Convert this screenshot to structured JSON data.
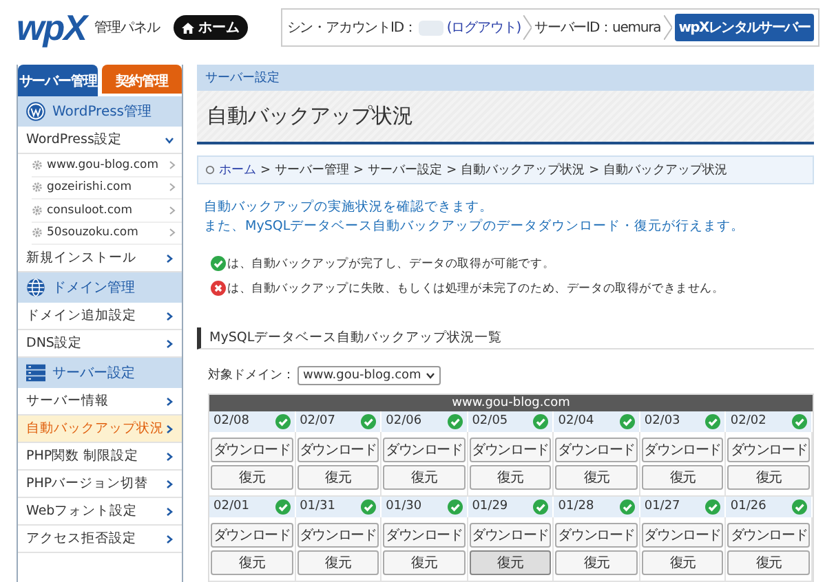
{
  "header": {
    "logo": "wpX",
    "panel_label": "管理パネル",
    "home_button": "ホーム",
    "account_label": "シン・アカウントID：",
    "account_id_blurred": true,
    "logout_link": "(ログアウト)",
    "server_id": "サーバーID：uemura",
    "service_button": "wpXレンタルサーバー"
  },
  "sidebar": {
    "tabs": [
      {
        "label": "サーバー管理",
        "selected": true,
        "color": "#1f5aa6"
      },
      {
        "label": "契約管理",
        "selected": false,
        "color": "#e0600f"
      }
    ],
    "sections": [
      {
        "kind": "wordpress",
        "title": "WordPress管理",
        "items": [
          {
            "label": "WordPress設定",
            "selected": false,
            "expanded": true,
            "children": [
              {
                "label": "www.gou-blog.com"
              },
              {
                "label": "gozeirishi.com"
              },
              {
                "label": "consuloot.com"
              },
              {
                "label": "50souzoku.com"
              }
            ]
          },
          {
            "label": "新規インストール",
            "selected": false,
            "expanded": false
          }
        ]
      },
      {
        "kind": "domain",
        "title": "ドメイン管理",
        "items": [
          {
            "label": "ドメイン追加設定",
            "selected": false,
            "expanded": false
          },
          {
            "label": "DNS設定",
            "selected": false,
            "expanded": false
          }
        ]
      },
      {
        "kind": "server",
        "title": "サーバー設定",
        "items": [
          {
            "label": "サーバー情報",
            "selected": false,
            "expanded": false
          },
          {
            "label": "自動バックアップ状況",
            "selected": true,
            "expanded": false
          },
          {
            "label": "PHP関数 制限設定",
            "selected": false,
            "expanded": false
          },
          {
            "label": "PHPバージョン切替",
            "selected": false,
            "expanded": false
          },
          {
            "label": "Webフォント設定",
            "selected": false,
            "expanded": false
          },
          {
            "label": "アクセス拒否設定",
            "selected": false,
            "expanded": false
          }
        ]
      }
    ]
  },
  "main": {
    "section_label": "サーバー設定",
    "title": "自動バックアップ状況",
    "breadcrumb": [
      {
        "label": "ホーム",
        "link": true
      },
      {
        "sep": ">",
        "label": "サーバー管理",
        "link": false
      },
      {
        "sep": ">",
        "label": "サーバー設定",
        "link": false
      },
      {
        "sep": ">",
        "label": "自動バックアップ状況",
        "link": false
      },
      {
        "sep": ">",
        "label": "自動バックアップ状況",
        "link": false
      }
    ],
    "description": [
      "自動バックアップの実施状況を確認できます。",
      "また、MySQLデータベース自動バックアップのデータダウンロード・復元が行えます。"
    ],
    "legend": [
      {
        "kind": "ok",
        "text": "は、自動バックアップが完了し、データの取得が可能です。"
      },
      {
        "kind": "error",
        "text": "は、自動バックアップに失敗、もしくは処理が未完了のため、データの取得ができません。"
      }
    ],
    "subheading": "MySQLデータベース自動バックアップ状況一覧",
    "domain_select": {
      "label": "対象ドメイン：",
      "value": "www.gou-blog.com"
    },
    "backups": {
      "domain": "www.gou-blog.com",
      "days": [
        {
          "date": "02/08",
          "complete": true,
          "download": "ダウンロード",
          "restore": "復元",
          "restore_pressed": false
        },
        {
          "date": "02/07",
          "complete": true,
          "download": "ダウンロード",
          "restore": "復元",
          "restore_pressed": false
        },
        {
          "date": "02/06",
          "complete": true,
          "download": "ダウンロード",
          "restore": "復元",
          "restore_pressed": false
        },
        {
          "date": "02/05",
          "complete": true,
          "download": "ダウンロード",
          "restore": "復元",
          "restore_pressed": false
        },
        {
          "date": "02/04",
          "complete": true,
          "download": "ダウンロード",
          "restore": "復元",
          "restore_pressed": false
        },
        {
          "date": "02/03",
          "complete": true,
          "download": "ダウンロード",
          "restore": "復元",
          "restore_pressed": false
        },
        {
          "date": "02/02",
          "complete": true,
          "download": "ダウンロード",
          "restore": "復元",
          "restore_pressed": false
        },
        {
          "date": "02/01",
          "complete": true,
          "download": "ダウンロード",
          "restore": "復元",
          "restore_pressed": false
        },
        {
          "date": "01/31",
          "complete": true,
          "download": "ダウンロード",
          "restore": "復元",
          "restore_pressed": false
        },
        {
          "date": "01/30",
          "complete": true,
          "download": "ダウンロード",
          "restore": "復元",
          "restore_pressed": false
        },
        {
          "date": "01/29",
          "complete": true,
          "download": "ダウンロード",
          "restore": "復元",
          "restore_pressed": true
        },
        {
          "date": "01/28",
          "complete": true,
          "download": "ダウンロード",
          "restore": "復元",
          "restore_pressed": false
        },
        {
          "date": "01/27",
          "complete": true,
          "download": "ダウンロード",
          "restore": "復元",
          "restore_pressed": false
        },
        {
          "date": "01/26",
          "complete": true,
          "download": "ダウンロード",
          "restore": "復元",
          "restore_pressed": false
        }
      ]
    }
  }
}
